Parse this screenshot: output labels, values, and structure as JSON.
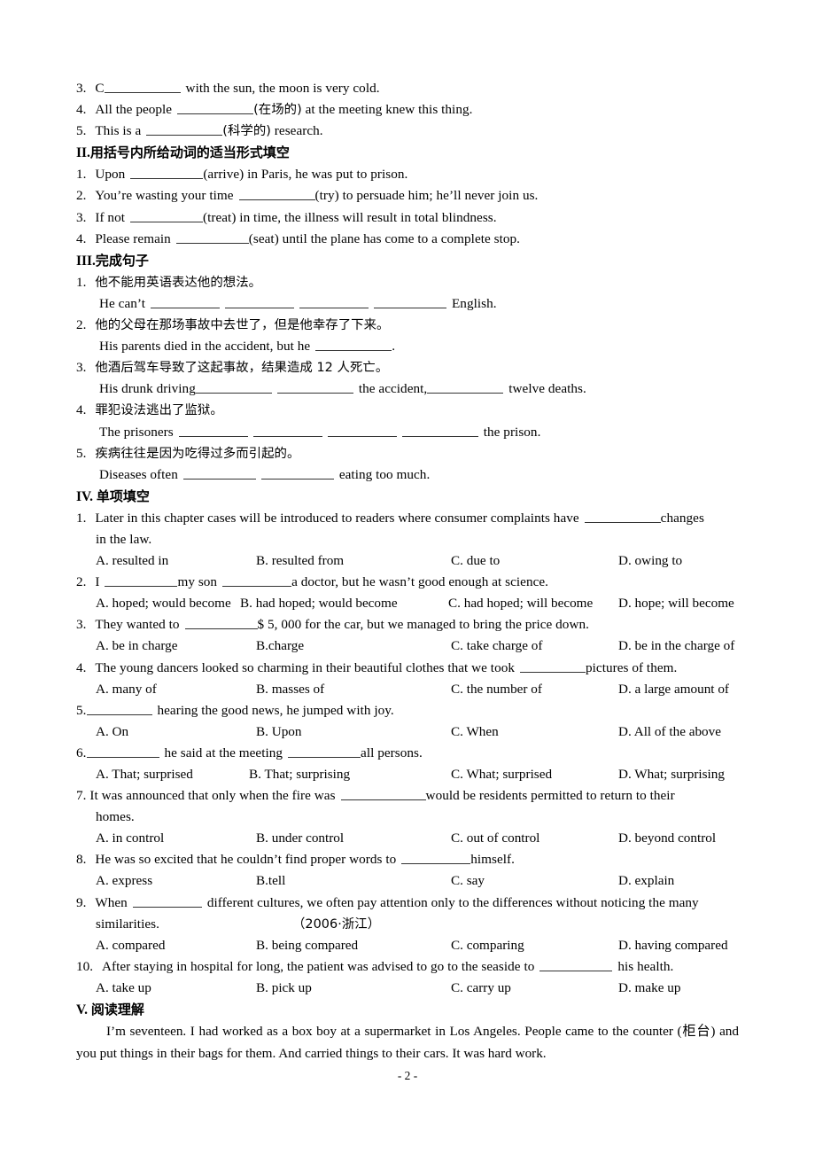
{
  "document": {
    "page_footer": "- 2 -"
  },
  "section_one_tail": {
    "items": [
      {
        "num": "3.",
        "pre": "C",
        "post": "with the sun, the moon is very cold."
      },
      {
        "num": "4.",
        "pre": "All the people",
        "hint": "(在场的)",
        "post": "at the meeting knew this thing."
      },
      {
        "num": "5.",
        "pre": "This is a",
        "hint": "(科学的)",
        "post": "research."
      }
    ]
  },
  "section_two": {
    "heading_num": "II.",
    "heading_cn": "用括号内所给动词的适当形式填空",
    "items": [
      {
        "num": "1.",
        "pre": "Upon",
        "hint": "(arrive)",
        "post": "in Paris, he was put to prison."
      },
      {
        "num": "2.",
        "pre": "You’re wasting your time",
        "hint": "(try)",
        "post": "to persuade him; he’ll never join us."
      },
      {
        "num": "3.",
        "pre": "If not",
        "hint": "(treat)",
        "post": "in time, the illness will result in total blindness."
      },
      {
        "num": "4.",
        "pre": "Please remain",
        "hint": "(seat)",
        "post": "until the plane has come to a complete stop."
      }
    ]
  },
  "section_three": {
    "heading_num": "III.",
    "heading_cn": "完成句子",
    "items": [
      {
        "num": "1.",
        "cn": "他不能用英语表达他的想法。",
        "en_pre": "He can’t",
        "en_post": "English."
      },
      {
        "num": "2.",
        "cn": "他的父母在那场事故中去世了，但是他幸存了下来。",
        "en_pre": "His parents died in the accident, but he",
        "en_post": "."
      },
      {
        "num": "3.",
        "cn": "他酒后驾车导致了这起事故，结果造成 12 人死亡。",
        "en_pre": "His drunk driving",
        "en_mid": "the accident,",
        "en_post": "twelve deaths."
      },
      {
        "num": "4.",
        "cn": "罪犯设法逃出了监狱。",
        "en_pre": "The prisoners",
        "en_post": "the prison."
      },
      {
        "num": "5.",
        "cn": "疾病往往是因为吃得过多而引起的。",
        "en_pre": "Diseases often",
        "en_post": "eating too much."
      }
    ]
  },
  "section_four": {
    "heading_num": "IV.",
    "heading_cn": "单项填空",
    "questions": [
      {
        "num": "1.",
        "stem_pre": "Later in this chapter cases will be introduced to readers where consumer complaints have",
        "stem_post": "changes",
        "stem_wrap": "in the law.",
        "options": [
          "A. resulted in",
          "B. resulted from",
          "C. due to",
          "D. owing to"
        ]
      },
      {
        "num": "2.",
        "stem_pre": "I",
        "stem_mid": "my son",
        "stem_post": "a doctor, but he wasn’t good enough at science.",
        "options": [
          "A. hoped; would become",
          "B. had hoped; would become",
          "C. had hoped; will become",
          "D. hope; will become"
        ]
      },
      {
        "num": "3.",
        "stem_pre": "They wanted to",
        "stem_post": "$ 5, 000 for the car, but we managed to bring the price down.",
        "options": [
          "A. be in charge",
          "B.charge",
          "C. take charge of",
          "D. be in the charge of"
        ]
      },
      {
        "num": "4.",
        "stem_pre": "The young dancers looked so charming in their beautiful clothes that we took",
        "stem_post": "pictures of them.",
        "options": [
          "A. many of",
          "B. masses of",
          "C. the number of",
          "D. a large amount of"
        ]
      },
      {
        "num": "5.",
        "stem_pre": "",
        "stem_post": "hearing the good news, he jumped with joy.",
        "options": [
          "A. On",
          "B.   Upon",
          "C. When",
          "D. All of the above"
        ]
      },
      {
        "num": "6.",
        "stem_pre": "",
        "stem_mid": "he said at the meeting",
        "stem_post": "all persons.",
        "options": [
          "A. That; surprised",
          "B.   That; surprising",
          "C. What; surprised",
          "D. What; surprising"
        ]
      },
      {
        "num": "7.",
        "stem_pre": "It was announced that only when the fire was",
        "stem_post": "would be residents permitted to return to their",
        "stem_wrap": "homes.",
        "options": [
          "A. in control",
          "B. under control",
          "C. out of control",
          "D. beyond control"
        ]
      },
      {
        "num": "8.",
        "stem_pre": "He was so excited that he couldn’t find proper words to",
        "stem_post": "himself.",
        "options": [
          "A. express",
          "B.tell",
          "C. say",
          "D. explain"
        ]
      },
      {
        "num": "9.",
        "stem_pre": "When",
        "stem_post": "different cultures, we often pay attention only to the differences without noticing the many",
        "stem_wrap": "similarities.",
        "source": "（2006·浙江）",
        "options": [
          "A. compared",
          "B. being compared",
          "C. comparing",
          "D. having compared"
        ]
      },
      {
        "num": "10.",
        "stem_pre": "After staying in hospital for long, the patient was advised to go to the seaside to",
        "stem_post": "his health.",
        "options": [
          "A. take up",
          "B. pick up",
          "C. carry up",
          "D. make up"
        ]
      }
    ]
  },
  "section_five": {
    "heading_num": "V.",
    "heading_cn": "阅读理解",
    "paragraph": "I’m seventeen. I had worked as a box boy at a supermarket in Los Angeles. People came to the counter (柜台) and you put things in their bags for them. And carried things to their cars. It was hard work."
  }
}
